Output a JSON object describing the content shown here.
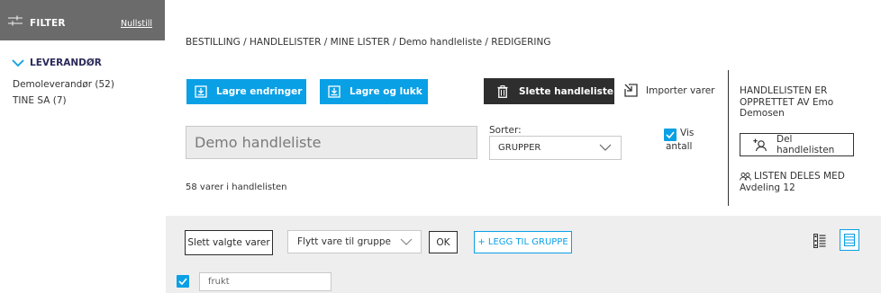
{
  "sidebar": {
    "filter_title": "FILTER",
    "reset_label": "Nullstill",
    "supplier_heading": "LEVERANDØR",
    "suppliers": [
      {
        "label": "Demoleverandør (52)"
      },
      {
        "label": "TINE SA (7)"
      }
    ]
  },
  "breadcrumb": "BESTILLING / HANDLELISTER / MINE LISTER / Demo handleliste / REDIGERING",
  "actions": {
    "save_changes": "Lagre endringer",
    "save_close": "Lagre og lukk",
    "delete_list": "Slette handleliste",
    "import_items": "Importer varer"
  },
  "list": {
    "name_value": "Demo handleliste",
    "sort_label": "Sorter:",
    "sort_value": "GRUPPER",
    "show_count_label_line1": "Vis",
    "show_count_label_line2": "antall",
    "show_count_checked": true,
    "item_count_text": "58 varer i handlelisten"
  },
  "info": {
    "created_by": "HANDLELISTEN ER OPPRETTET AV Emo Demosen",
    "share_button": "Del handlelisten",
    "shared_with_label": "LISTEN DELES MED",
    "shared_with_value": "Avdeling 12"
  },
  "toolbar": {
    "delete_selected": "Slett valgte varer",
    "move_placeholder": "Flytt vare til gruppe",
    "ok_label": "OK",
    "add_group": "+ LEGG TIL GRUPPE"
  },
  "group_row": {
    "checked": true,
    "group_name_value": "frukt"
  },
  "colors": {
    "accent": "#0aa0e6",
    "filter_bar": "#6b6b6b",
    "dark_button": "#2e2e2e",
    "band": "#eeeeee"
  },
  "icons": {
    "filter": "sliders-icon",
    "chevron": "chevron-down-icon",
    "save": "save-icon",
    "trash": "trash-icon",
    "import": "import-icon",
    "add_user": "add-user-icon",
    "group": "users-icon",
    "view_compact": "list-compact-icon",
    "view_list": "list-icon"
  }
}
